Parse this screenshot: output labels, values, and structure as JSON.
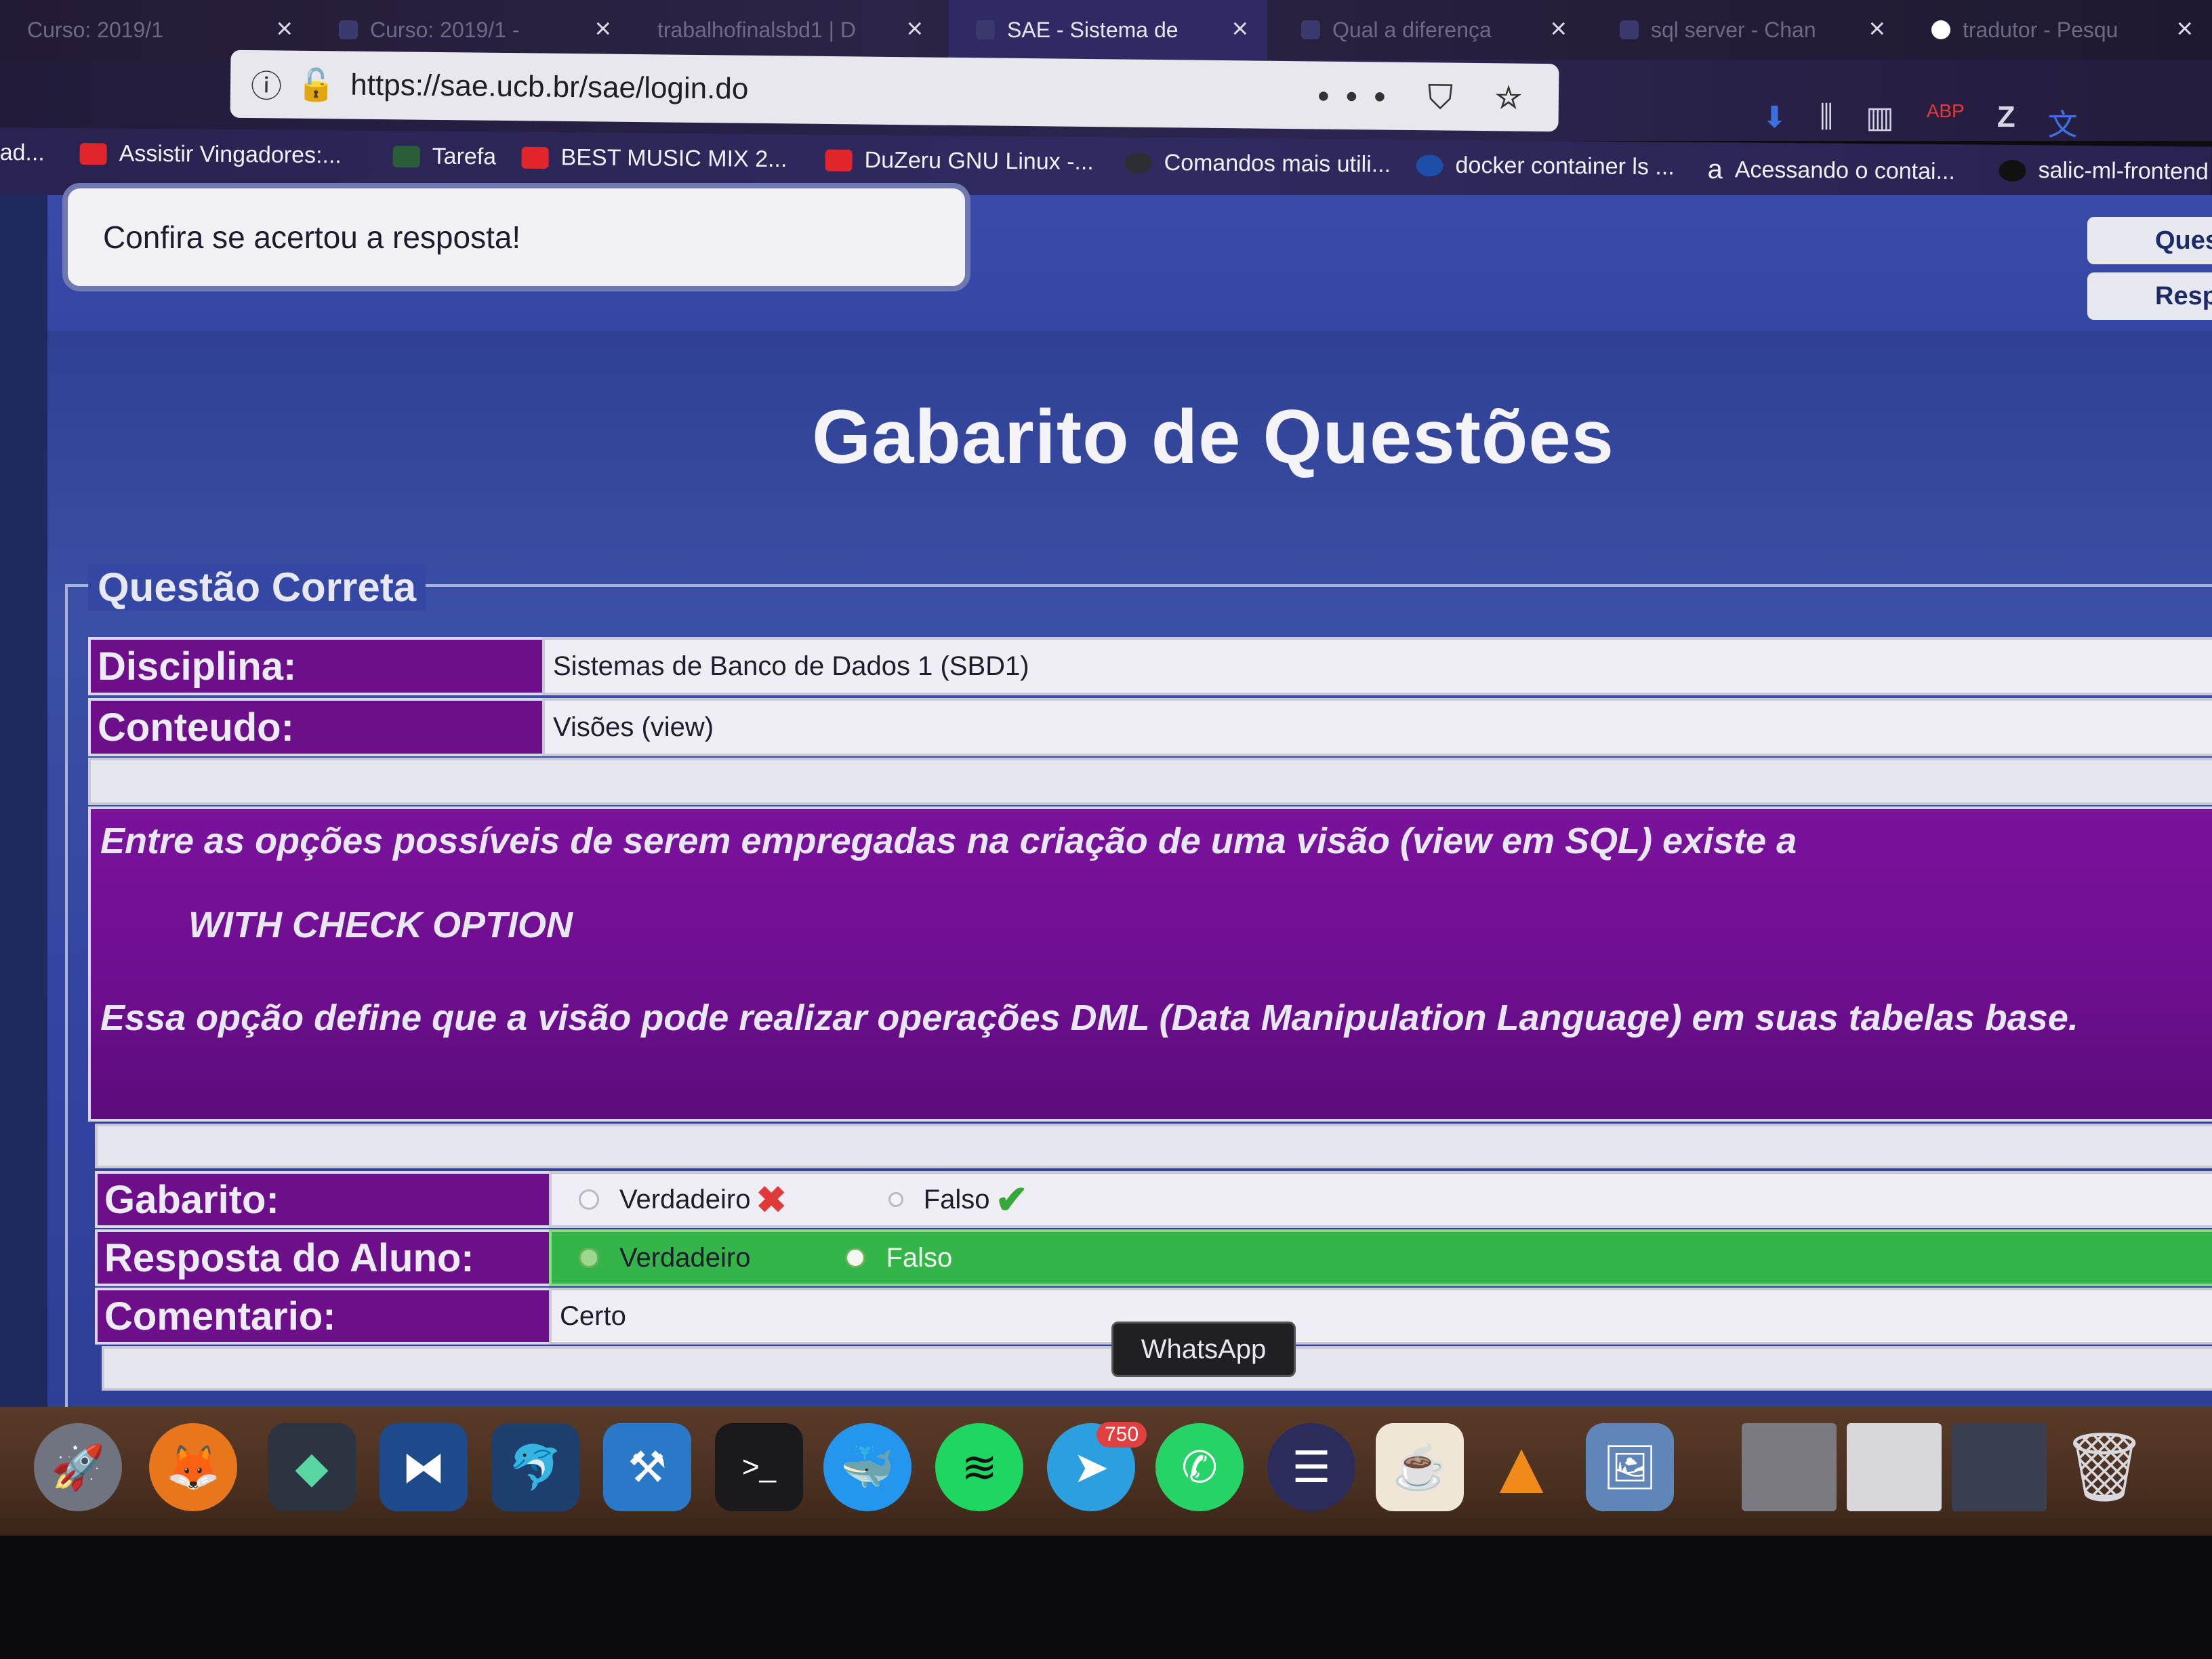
{
  "browser": {
    "tabs": [
      {
        "title": "Curso: 2019/1",
        "active": false
      },
      {
        "title": "Curso: 2019/1 -",
        "active": false
      },
      {
        "title": "trabalhofinalsbd1 | D",
        "active": false
      },
      {
        "title": "SAE - Sistema de",
        "active": true
      },
      {
        "title": "Qual a diferença",
        "active": false
      },
      {
        "title": "sql server - Chan",
        "active": false
      },
      {
        "title": "tradutor - Pesqu",
        "active": false
      }
    ],
    "url": "https://sae.ucb.br/sae/login.do",
    "bookmarks": [
      {
        "label": "ad..."
      },
      {
        "label": "Assistir Vingadores:..."
      },
      {
        "label": "Tarefa"
      },
      {
        "label": "BEST MUSIC MIX 2..."
      },
      {
        "label": "DuZeru GNU Linux -..."
      },
      {
        "label": "Comandos mais utili..."
      },
      {
        "label": "docker container ls ..."
      },
      {
        "label": "Acessando o contai..."
      },
      {
        "label": "salic-ml-frontend"
      }
    ],
    "toolbar_icons": [
      "download-icon",
      "library-icon",
      "reader-icon",
      "abp-icon",
      "zotero-icon",
      "translate-icon"
    ]
  },
  "header": {
    "tooltip": "Confira se acertou a resposta!",
    "side_buttons": [
      "Ques",
      "Respo"
    ]
  },
  "page": {
    "title": "Gabarito de Questões",
    "section_legend": "Questão Correta",
    "disciplina_label": "Disciplina:",
    "disciplina_value": "Sistemas de Banco de Dados 1 (SBD1)",
    "conteudo_label": "Conteudo:",
    "conteudo_value": "Visões (view)",
    "question_line1": "Entre as opções possíveis de serem empregadas na criação de uma visão (view em SQL) existe a",
    "question_line2": "WITH CHECK OPTION",
    "question_line3": "Essa opção define que a visão pode realizar operações DML (Data Manipulation Language) em suas tabelas base.",
    "gabarito_label": "Gabarito:",
    "gabarito_opt_true": "Verdadeiro",
    "gabarito_opt_false": "Falso",
    "gabarito_answer": "Falso",
    "resposta_label": "Resposta do Aluno:",
    "resposta_opt_true": "Verdadeiro",
    "resposta_opt_false": "Falso",
    "resposta_selected": "Falso",
    "comentario_label": "Comentario:",
    "comentario_value": "Certo"
  },
  "dock": {
    "tooltip": "WhatsApp",
    "telegram_badge": "750",
    "apps": [
      "launchpad-icon",
      "firefox-icon",
      "kdenlive-icon",
      "vscode-icon",
      "mysql-workbench-icon",
      "xcode-icon",
      "terminal-icon",
      "docker-icon",
      "spotify-icon",
      "telegram-icon",
      "whatsapp-icon",
      "eclipse-icon",
      "java-icon",
      "vlc-icon",
      "preview-icon",
      "window-thumb-icon",
      "window-thumb-icon",
      "window-thumb-icon",
      "trash-icon"
    ]
  },
  "colors": {
    "page_bg": "#3447a2",
    "label_bg": "#6d0f8a",
    "answer_green": "#33b54a",
    "wrong_red": "#e03a3a",
    "correct_green": "#36a83a"
  }
}
